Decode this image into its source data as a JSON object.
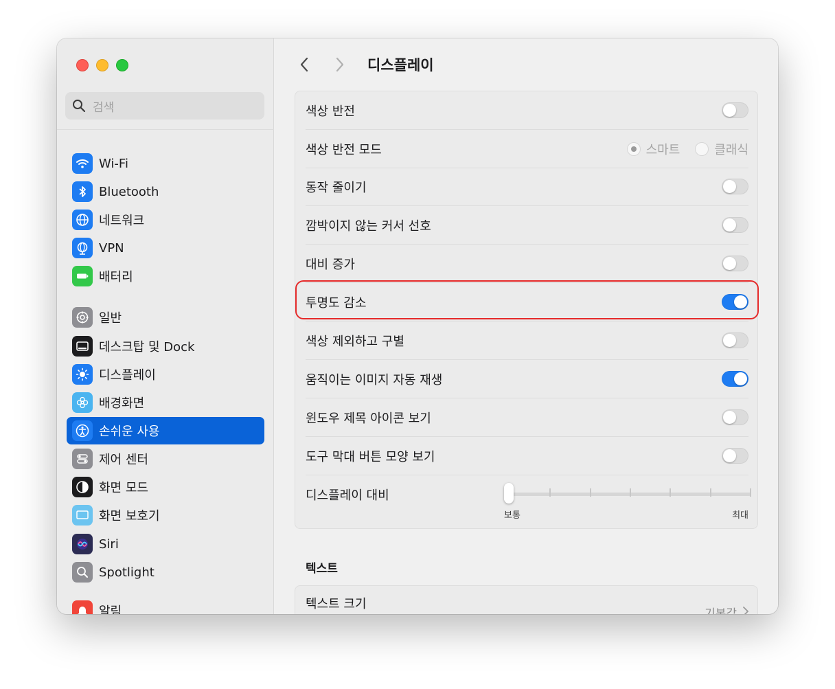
{
  "window": {
    "title": "디스플레이"
  },
  "search": {
    "placeholder": "검색"
  },
  "sidebar": {
    "items": [
      {
        "label": "Wi-Fi",
        "icon": "wifi-icon",
        "color": "#1e7cf2",
        "active": false
      },
      {
        "label": "Bluetooth",
        "icon": "bluetooth-icon",
        "color": "#1e7cf2",
        "active": false
      },
      {
        "label": "네트워크",
        "icon": "globe-icon",
        "color": "#1e7cf2",
        "active": false
      },
      {
        "label": "VPN",
        "icon": "vpn-globe-icon",
        "color": "#1e7cf2",
        "active": false
      },
      {
        "label": "배터리",
        "icon": "battery-icon",
        "color": "#33c84a",
        "active": false
      },
      {
        "label": "일반",
        "icon": "gear-icon",
        "color": "#8e8e93",
        "active": false
      },
      {
        "label": "데스크탑 및 Dock",
        "icon": "dock-icon",
        "color": "#1c1c1e",
        "active": false
      },
      {
        "label": "디스플레이",
        "icon": "sun-icon",
        "color": "#1e7cf2",
        "active": false
      },
      {
        "label": "배경화면",
        "icon": "flower-icon",
        "color": "#4ab4f0",
        "active": false
      },
      {
        "label": "손쉬운 사용",
        "icon": "accessibility-icon",
        "color": "#1e7cf2",
        "active": true
      },
      {
        "label": "제어 센터",
        "icon": "control-center-icon",
        "color": "#8e8e93",
        "active": false
      },
      {
        "label": "화면 모드",
        "icon": "appearance-icon",
        "color": "#1c1c1e",
        "active": false
      },
      {
        "label": "화면 보호기",
        "icon": "screensaver-icon",
        "color": "#6cc4f0",
        "active": false
      },
      {
        "label": "Siri",
        "icon": "siri-icon",
        "color": "#2c2c54",
        "active": false
      },
      {
        "label": "Spotlight",
        "icon": "magnifier-icon",
        "color": "#8e8e93",
        "active": false
      },
      {
        "label": "알림",
        "icon": "bell-icon",
        "color": "#f0453a",
        "active": false
      }
    ]
  },
  "settings": {
    "rows": [
      {
        "label": "색상 반전",
        "type": "toggle",
        "on": false
      },
      {
        "label": "색상 반전 모드",
        "type": "radio",
        "options": [
          "스마트",
          "클래식"
        ],
        "selected": "스마트"
      },
      {
        "label": "동작 줄이기",
        "type": "toggle",
        "on": false
      },
      {
        "label": "깜박이지 않는 커서 선호",
        "type": "toggle",
        "on": false
      },
      {
        "label": "대비 증가",
        "type": "toggle",
        "on": false
      },
      {
        "label": "투명도 감소",
        "type": "toggle",
        "on": true,
        "highlighted": true
      },
      {
        "label": "색상 제외하고 구별",
        "type": "toggle",
        "on": false
      },
      {
        "label": "움직이는 이미지 자동 재생",
        "type": "toggle",
        "on": true
      },
      {
        "label": "윈도우 제목 아이콘 보기",
        "type": "toggle",
        "on": false
      },
      {
        "label": "도구 막대 버튼 모양 보기",
        "type": "toggle",
        "on": false
      }
    ],
    "contrast_slider": {
      "label": "디스플레이 대비",
      "min_label": "보통",
      "max_label": "최대",
      "value": 0,
      "ticks": 7
    }
  },
  "text_section": {
    "title": "텍스트",
    "rows": [
      {
        "label": "텍스트 크기",
        "value": "기본값"
      }
    ]
  },
  "colors": {
    "accent": "#0a63d8",
    "toggle_on": "#1e7cf2",
    "highlight": "#e52a2a"
  }
}
